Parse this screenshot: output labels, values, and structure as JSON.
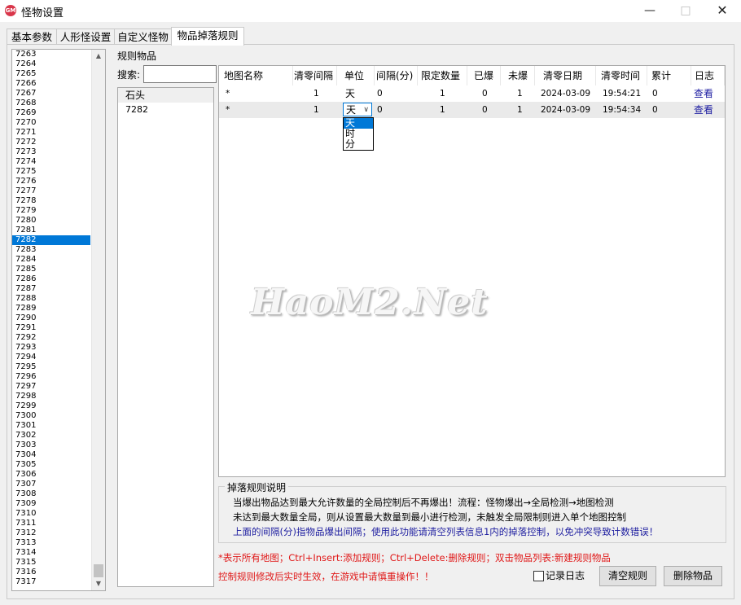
{
  "window": {
    "title": "怪物设置",
    "icon_text": "GM"
  },
  "tabs": [
    "基本参数",
    "人形怪设置",
    "自定义怪物",
    "物品掉落规则"
  ],
  "id_list": {
    "items": [
      "7263",
      "7264",
      "7265",
      "7266",
      "7267",
      "7268",
      "7269",
      "7270",
      "7271",
      "7272",
      "7273",
      "7274",
      "7275",
      "7276",
      "7277",
      "7278",
      "7279",
      "7280",
      "7281",
      "7282",
      "7283",
      "7284",
      "7285",
      "7286",
      "7287",
      "7288",
      "7289",
      "7290",
      "7291",
      "7292",
      "7293",
      "7294",
      "7295",
      "7296",
      "7297",
      "7298",
      "7299",
      "7300",
      "7301",
      "7302",
      "7303",
      "7304",
      "7305",
      "7306",
      "7307",
      "7308",
      "7309",
      "7310",
      "7311",
      "7312",
      "7313",
      "7314",
      "7315",
      "7316",
      "7317"
    ],
    "selected": "7282"
  },
  "rule_items": {
    "group_label": "规则物品",
    "search_label": "搜索:",
    "search_value": "",
    "items": [
      {
        "name": "石头"
      },
      {
        "name": "7282"
      }
    ]
  },
  "grid": {
    "headers": [
      "地图名称",
      "清零间隔",
      "单位",
      "间隔(分)",
      "限定数量",
      "已爆",
      "未爆",
      "清零日期",
      "清零时间",
      "累计",
      "日志"
    ],
    "rows": [
      {
        "map": "*",
        "interval": "1",
        "unit": "天",
        "minutes": "0",
        "limit": "1",
        "dropped": "0",
        "remaining": "1",
        "date": "2024-03-09",
        "time": "19:54:21",
        "total": "0",
        "log": "查看"
      },
      {
        "map": "*",
        "interval": "1",
        "unit": "天",
        "minutes": "0",
        "limit": "1",
        "dropped": "0",
        "remaining": "1",
        "date": "2024-03-09",
        "time": "19:54:34",
        "total": "0",
        "log": "查看"
      }
    ],
    "dropdown": {
      "selected": "天",
      "options": [
        "天",
        "时",
        "分"
      ]
    }
  },
  "watermark": "HaoM2.Net",
  "rules": {
    "title": "掉落规则说明",
    "lines": [
      "当爆出物品达到最大允许数量的全局控制后不再爆出！流程：怪物爆出→全局检测→地图检测",
      "未达到最大数量全局，则从设置最大数量到最小进行检测，未触发全局限制则进入单个地图控制",
      "上面的间隔(分)指物品爆出间隔；使用此功能请清空列表信息1内的掉落控制，以免冲突导致计数错误！"
    ]
  },
  "footer": {
    "hint1": "*表示所有地图；Ctrl+Insert:添加规则；Ctrl+Delete:删除规则；双击物品列表:新建规则物品",
    "hint2": "控制规则修改后实时生效，在游戏中请慎重操作！！",
    "log_checkbox_label": "记录日志",
    "clear_button": "清空规则",
    "delete_button": "删除物品"
  },
  "colors": {
    "selection": "#0078d7",
    "warning_red": "#e01818",
    "link_blue": "#1a1aa0"
  }
}
